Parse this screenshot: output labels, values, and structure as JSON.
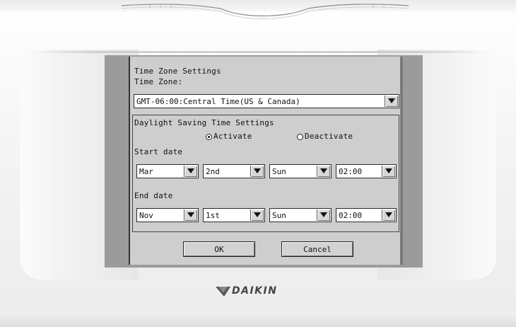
{
  "dialog": {
    "title": "Time Zone Settings",
    "timezone_label": "Time Zone:",
    "timezone_value": "GMT-06:00:Central Time(US & Canada)"
  },
  "dst": {
    "title": "Daylight Saving Time Settings",
    "activate_label": "Activate",
    "deactivate_label": "Deactivate",
    "selected": "Activate",
    "start_label": "Start date",
    "end_label": "End date",
    "start": {
      "month": "Mar",
      "week": "2nd",
      "day": "Sun",
      "time": "02:00"
    },
    "end": {
      "month": "Nov",
      "week": "1st",
      "day": "Sun",
      "time": "02:00"
    }
  },
  "buttons": {
    "ok": "OK",
    "cancel": "Cancel"
  },
  "brand": {
    "name": "DAIKIN"
  },
  "icons": {
    "dropdown": "triangle-down-icon",
    "logo": "daikin-chevron-logo"
  },
  "colors": {
    "screen_bg": "#cecece",
    "bezel": "#9b9b9b",
    "device": "#f2f2f2"
  }
}
